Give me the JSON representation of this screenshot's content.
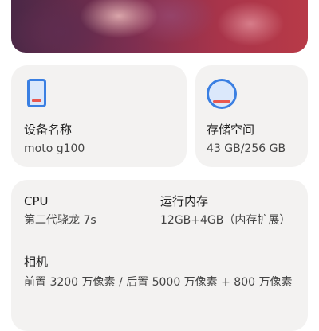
{
  "device_card": {
    "icon": "phone-icon",
    "label": "设备名称",
    "value": "moto g100",
    "icon_color": "#3a7fe2",
    "accent_color": "#e9574f"
  },
  "storage_card": {
    "icon": "storage-icon",
    "label": "存储空间",
    "value": "43 GB/256 GB",
    "used_fraction": 0.168
  },
  "specs": {
    "cpu": {
      "label": "CPU",
      "value": "第二代骁龙 7s"
    },
    "ram": {
      "label": "运行内存",
      "value": "12GB+4GB（内存扩展）"
    },
    "camera": {
      "label": "相机",
      "value": "前置 3200 万像素 / 后置 5000 万像素 + 800 万像素"
    }
  }
}
